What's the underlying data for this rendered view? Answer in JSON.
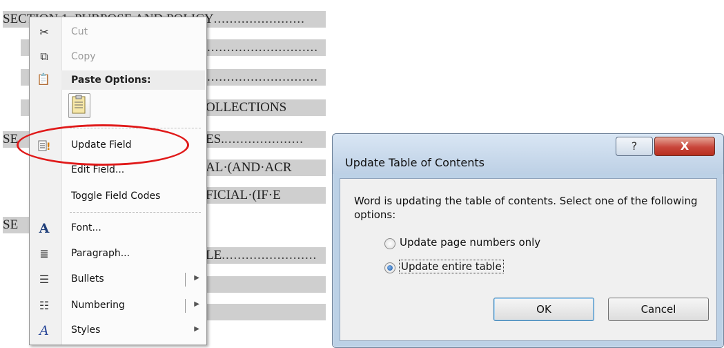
{
  "document": {
    "toc_lines": [
      {
        "text": "SECTION 1. PURPOSE AND POLICY",
        "dots": "......................."
      },
      {
        "text": "",
        "dots": "............................"
      },
      {
        "text": "",
        "dots": "............................"
      },
      {
        "text": "OLLECTIONS",
        "dots": ""
      },
      {
        "text": "SE",
        "dots": ""
      },
      {
        "text": "ES.",
        "dots": "...................."
      },
      {
        "text": "AL·(AND·ACR",
        "dots": ""
      },
      {
        "text": "FICIAL·(IF·E",
        "dots": ""
      },
      {
        "text": "SE",
        "dots": ""
      },
      {
        "text": "LE",
        "dots": "........................"
      }
    ]
  },
  "context_menu": {
    "items": [
      {
        "label": "Cut",
        "icon": "scissors-icon",
        "glyph": "✂",
        "enabled": false
      },
      {
        "label": "Copy",
        "icon": "copy-icon",
        "glyph": "⧉",
        "enabled": false
      },
      {
        "label": "Paste Options:",
        "icon": "paste-icon",
        "glyph": "📋"
      },
      {
        "label": "Update Field",
        "icon": "update-field-icon",
        "glyph": "!"
      },
      {
        "label": "Edit Field...",
        "icon": "",
        "glyph": ""
      },
      {
        "label": "Toggle Field Codes",
        "icon": "",
        "glyph": ""
      },
      {
        "label": "Font...",
        "icon": "font-icon",
        "glyph": "A"
      },
      {
        "label": "Paragraph...",
        "icon": "paragraph-icon",
        "glyph": "≣"
      },
      {
        "label": "Bullets",
        "icon": "bullets-icon",
        "glyph": "☰",
        "submenu": true
      },
      {
        "label": "Numbering",
        "icon": "numbering-icon",
        "glyph": "☷",
        "submenu": true
      },
      {
        "label": "Styles",
        "icon": "styles-icon",
        "glyph": "A",
        "submenu": true
      }
    ],
    "submenu_arrow": "▶",
    "highlight_color": "#e01a1a"
  },
  "dialog": {
    "title": "Update Table of Contents",
    "help_label": "?",
    "close_label": "X",
    "message": "Word is updating the table of contents.  Select one of the following options:",
    "options": [
      {
        "label": "Update page numbers only",
        "checked": false
      },
      {
        "label": "Update entire table",
        "checked": true
      }
    ],
    "ok_label": "OK",
    "cancel_label": "Cancel"
  }
}
